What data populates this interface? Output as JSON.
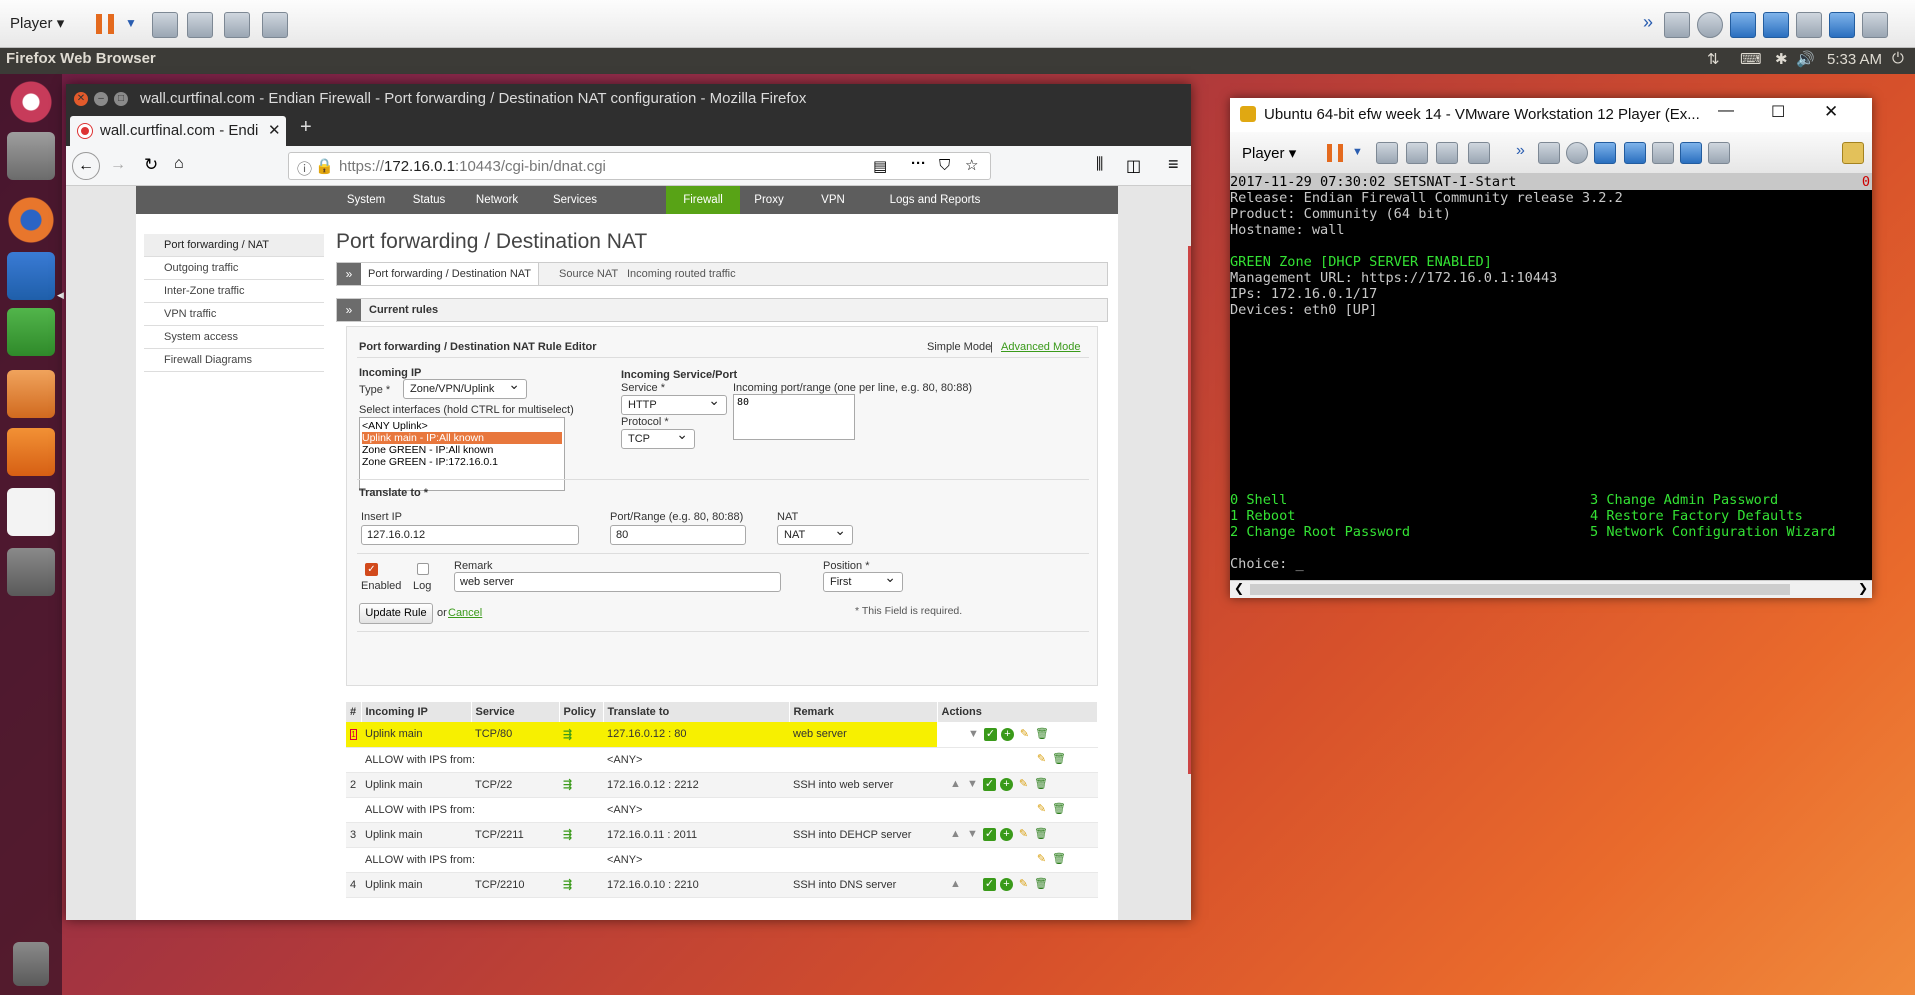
{
  "vmware_toolbar": {
    "player_label": "Player"
  },
  "ubuntu_panel": {
    "app_name": "Firefox Web Browser",
    "time": "5:33 AM"
  },
  "firefox": {
    "window_title": "wall.curtfinal.com - Endian Firewall - Port forwarding / Destination NAT configuration - Mozilla Firefox",
    "tab_title": "wall.curtfinal.com - Endi",
    "url_prefix": "https://",
    "url_host": "172.16.0.1",
    "url_rest": ":10443/cgi-bin/dnat.cgi"
  },
  "endian": {
    "topnav": [
      "System",
      "Status",
      "Network",
      "Services",
      "Firewall",
      "Proxy",
      "VPN",
      "Logs and Reports"
    ],
    "leftmenu": [
      "Port forwarding / NAT",
      "Outgoing traffic",
      "Inter-Zone traffic",
      "VPN traffic",
      "System access",
      "Firewall Diagrams"
    ],
    "page_title": "Port forwarding / Destination NAT",
    "subtabs": [
      "Port forwarding / Destination NAT",
      "Source NAT",
      "Incoming routed traffic"
    ],
    "current_rules": "Current rules",
    "editor": {
      "title": "Port forwarding / Destination NAT Rule Editor",
      "simple_mode": "Simple Mode",
      "separator": "|",
      "advanced_mode": "Advanced Mode",
      "incoming_ip": "Incoming IP",
      "type_label": "Type *",
      "type_value": "Zone/VPN/Uplink",
      "select_label": "Select interfaces (hold CTRL for multiselect)",
      "interfaces": [
        "<ANY Uplink>",
        "Uplink main - IP:All known",
        "Zone GREEN - IP:All known",
        "Zone GREEN - IP:172.16.0.1"
      ],
      "incoming_service": "Incoming Service/Port",
      "service_label": "Service *",
      "service_value": "HTTP",
      "protocol_label": "Protocol *",
      "protocol_value": "TCP",
      "port_label": "Incoming port/range (one per line, e.g. 80, 80:88)",
      "port_value": "80",
      "translate_to": "Translate to *",
      "insert_ip_label": "Insert IP",
      "insert_ip_value": "127.16.0.12",
      "port_range_label": "Port/Range (e.g. 80, 80:88)",
      "port_range_value": "80",
      "nat_label": "NAT",
      "nat_value": "NAT",
      "enabled_label": "Enabled",
      "log_label": "Log",
      "remark_label": "Remark",
      "remark_value": "web server",
      "position_label": "Position *",
      "position_value": "First",
      "update_button": "Update Rule",
      "or_text": "or",
      "cancel": "Cancel",
      "required_note": "* This Field is required."
    },
    "table_headers": [
      "#",
      "Incoming IP",
      "Service",
      "Policy",
      "Translate to",
      "Remark",
      "Actions"
    ],
    "rules": [
      {
        "num": "1",
        "incoming": "Uplink main",
        "service": "TCP/80",
        "translate": "127.16.0.12 : 80",
        "remark": "web server",
        "allow": "ALLOW with IPS from:",
        "any": "<ANY>"
      },
      {
        "num": "2",
        "incoming": "Uplink main",
        "service": "TCP/22",
        "translate": "172.16.0.12 : 2212",
        "remark": "SSH into web server",
        "allow": "ALLOW with IPS from:",
        "any": "<ANY>"
      },
      {
        "num": "3",
        "incoming": "Uplink main",
        "service": "TCP/2211",
        "translate": "172.16.0.11 : 2011",
        "remark": "SSH into DEHCP server",
        "allow": "ALLOW with IPS from:",
        "any": "<ANY>"
      },
      {
        "num": "4",
        "incoming": "Uplink main",
        "service": "TCP/2210",
        "translate": "172.16.0.10 : 2210",
        "remark": "SSH into DNS server"
      }
    ]
  },
  "vm_window": {
    "title": "Ubuntu 64-bit efw week 14 - VMware Workstation 12 Player (Ex...",
    "player_label": "Player",
    "terminal": {
      "header": "2017-11-29 07:30:02 SETSNAT-I-Start",
      "header_flag": "0",
      "release": "Release: Endian Firewall Community release 3.2.2",
      "product": "Product: Community (64 bit)",
      "hostname": "Hostname: wall",
      "green_zone": "GREEN Zone [DHCP SERVER ENABLED]",
      "mgmt_url": "Management URL: https://172.16.0.1:10443",
      "ips": "IPs: 172.16.0.1/17",
      "devices": "Devices: eth0 [UP]",
      "menu_left": [
        "0 Shell",
        "1 Reboot",
        "2 Change Root Password"
      ],
      "menu_right": [
        "3 Change Admin Password",
        "4 Restore Factory Defaults",
        "5 Network Configuration Wizard"
      ],
      "choice": "Choice: _"
    }
  }
}
